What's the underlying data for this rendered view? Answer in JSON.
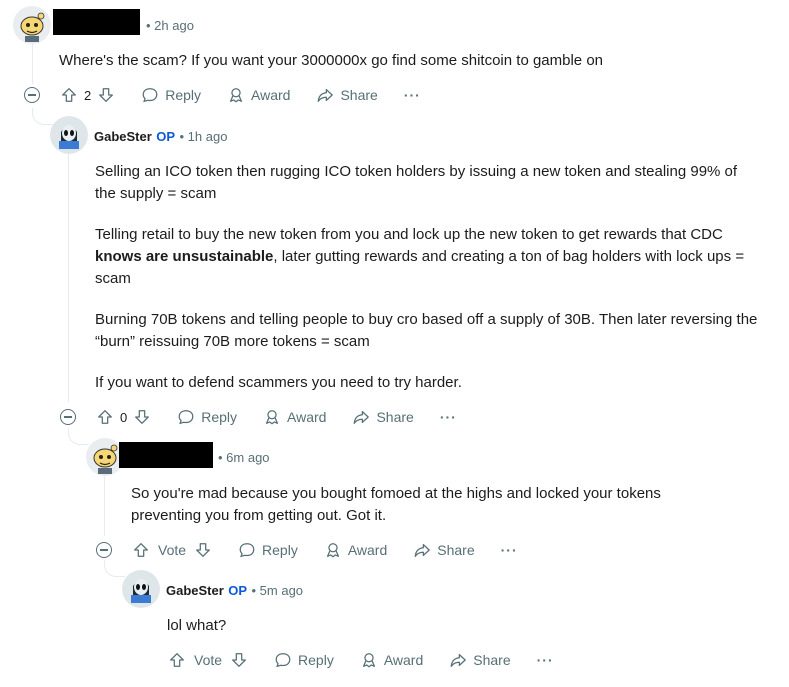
{
  "comment1": {
    "time": "• 2h ago",
    "text": "Where's the scam? If you want your 3000000x go find some shitcoin to gamble on",
    "votes": "2"
  },
  "comment2": {
    "author": "GabeSter",
    "op": "OP",
    "time": "• 1h ago",
    "paragraphs": {
      "p1": "Selling an ICO token then rugging ICO token holders by issuing a new token and stealing 99% of the supply = scam",
      "p2_before": "Telling retail to buy the new token from you and lock up the new token to get rewards that CDC ",
      "p2_bold": "knows are unsustainable",
      "p2_after": ", later gutting rewards and creating a ton of bag holders with lock ups = scam",
      "p3": "Burning 70B tokens and telling people to buy cro based off a supply of 30B. Then later reversing the “burn” reissuing 70B more tokens = scam",
      "p4": "If you want to defend scammers you need to try harder."
    },
    "votes": "0"
  },
  "comment3": {
    "time": "• 6m ago",
    "text": "So you're mad because you bought fomoed at the highs and locked your tokens preventing you from getting out. Got it.",
    "votes": "Vote"
  },
  "comment4": {
    "author": "GabeSter",
    "op": "OP",
    "time": "• 5m ago",
    "text": "lol what?",
    "votes": "Vote"
  },
  "actions": {
    "reply": "Reply",
    "award": "Award",
    "share": "Share",
    "more": "···"
  },
  "icons": {
    "upvote": "upvote-arrow-icon",
    "downvote": "downvote-arrow-icon",
    "reply": "speech-bubble-icon",
    "award": "award-ribbon-icon",
    "share": "share-arrow-icon",
    "collapse": "collapse-minus-icon"
  }
}
